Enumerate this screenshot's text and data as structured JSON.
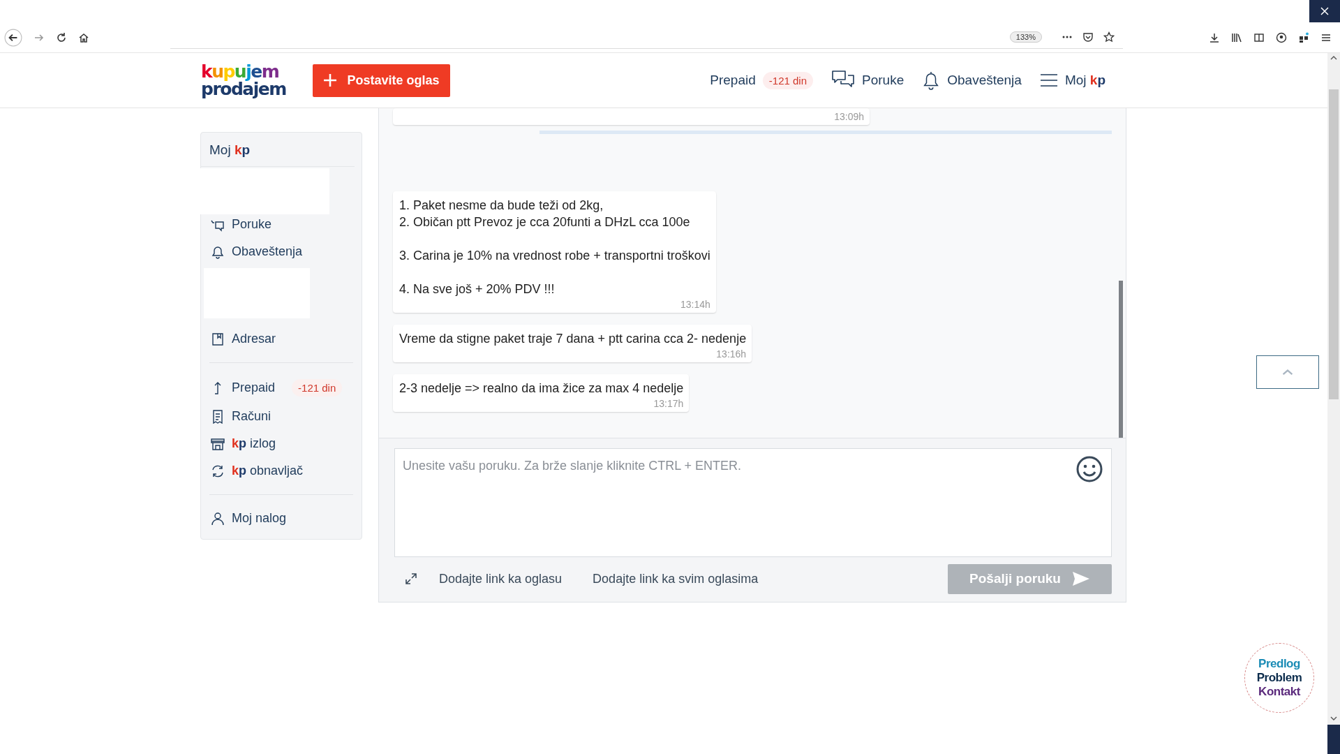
{
  "browser": {
    "zoom": "133%"
  },
  "header": {
    "logo": {
      "line_1": "kupujem",
      "line_2": "prodajem"
    },
    "post_button": "Postavite oglas",
    "nav": [
      {
        "kind": "prepaid",
        "label": "Prepaid",
        "badge": "-121 din"
      },
      {
        "kind": "messages",
        "label": "Poruke"
      },
      {
        "kind": "notifications",
        "label": "Obaveštenja"
      },
      {
        "kind": "menu",
        "label": "Moj",
        "brand": "kp"
      }
    ]
  },
  "sidebar": {
    "title": "Moj",
    "brand": "kp",
    "items": [
      {
        "kind": "blank"
      },
      {
        "kind": "messages",
        "label": "Poruke"
      },
      {
        "kind": "bell",
        "label": "Obaveštenja"
      },
      {
        "kind": "blank"
      },
      {
        "kind": "book",
        "label": "Adresar"
      },
      {
        "kind": "divider"
      },
      {
        "kind": "arrow",
        "label": "Prepaid",
        "badge": "-121 din"
      },
      {
        "kind": "receipt",
        "label": "Računi"
      },
      {
        "kind": "shop",
        "brand": "kp",
        "label": "izlog"
      },
      {
        "kind": "refresh",
        "brand": "kp",
        "label": "obnavljač"
      },
      {
        "kind": "divider"
      },
      {
        "kind": "user",
        "label": "Moj nalog"
      }
    ]
  },
  "chat": {
    "messages": [
      {
        "kind": "partial",
        "time": "13:09h"
      },
      {
        "kind": "full",
        "text": "1. Paket nesme da bude teži od 2kg,\n2. Običan ptt Prevoz je cca 20funti a DHzL cca 100e\n\n3. Carina je 10% na vrednost robe + transportni troškovi\n\n4. Na sve još + 20% PDV !!!",
        "time": "13:14h"
      },
      {
        "kind": "full",
        "text": "Vreme da stigne paket traje 7 dana + ptt carina cca 2- nedenje",
        "time": "13:16h"
      },
      {
        "kind": "full",
        "text": "2-3 nedelje => realno da ima žice za max 4 nedelje",
        "time": "13:17h"
      }
    ],
    "input": {
      "placeholder": "Unesite vašu poruku. Za brže slanje kliknite CTRL + ENTER."
    },
    "links": [
      "Dodajte link ka oglasu",
      "Dodajte link ka svim oglasima"
    ],
    "send_button": {
      "label": "Pošalji poruku",
      "disabled": true
    }
  },
  "feedback": [
    "Predlog",
    "Problem",
    "Kontakt"
  ]
}
